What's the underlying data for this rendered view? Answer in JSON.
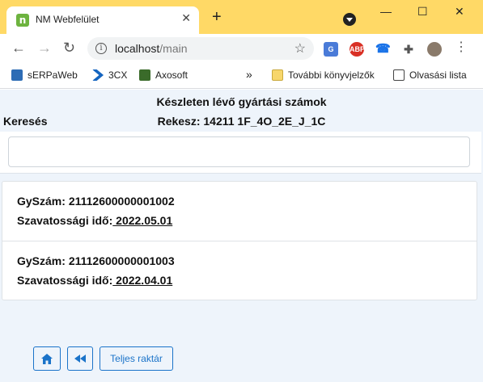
{
  "browser": {
    "tab_title": "NM Webfelület",
    "tab_close": "✕",
    "new_tab": "+",
    "window_min": "—",
    "window_max": "☐",
    "window_close": "✕",
    "url_host": "localhost",
    "url_path": "/main",
    "extensions": [
      {
        "name": "google-translate",
        "color": "#4a7bd8"
      },
      {
        "name": "adblock-plus",
        "label": "ABP",
        "color": "#d93025"
      },
      {
        "name": "phone-extension",
        "badge": "1",
        "color": "#1a73e8"
      },
      {
        "name": "puzzle-extensions",
        "color": "#555555"
      },
      {
        "name": "profile-avatar",
        "color": "#8a7a6a"
      }
    ],
    "bookmarks": [
      {
        "label": "sERPaWeb",
        "icon": "serpaweb-icon"
      },
      {
        "label": "3CX",
        "icon": "3cx-icon"
      },
      {
        "label": "Axosoft",
        "icon": "axosoft-icon"
      }
    ],
    "bookmarks_overflow": "»",
    "other_bookmarks": "További könyvjelzők",
    "reading_list": "Olvasási lista"
  },
  "header": {
    "title": "Készleten lévő gyártási számok",
    "search_label": "Keresés",
    "shelf": "Rekesz: 14211 1F_4O_2E_J_1C"
  },
  "search": {
    "placeholder": "",
    "value": ""
  },
  "items": [
    {
      "gyszam_label": "GySzám: ",
      "gyszam": "21112600000001002",
      "warranty_label": "Szavatossági idő:",
      "warranty": " 2022.05.01"
    },
    {
      "gyszam_label": "GySzám: ",
      "gyszam": "21112600000001003",
      "warranty_label": "Szavatossági idő:",
      "warranty": " 2022.04.01"
    }
  ],
  "footer": {
    "full_stock_label": "Teljes raktár"
  },
  "colors": {
    "accent": "#1a73c9",
    "tabbar": "#ffd966",
    "page_bg": "#eef4fb"
  }
}
